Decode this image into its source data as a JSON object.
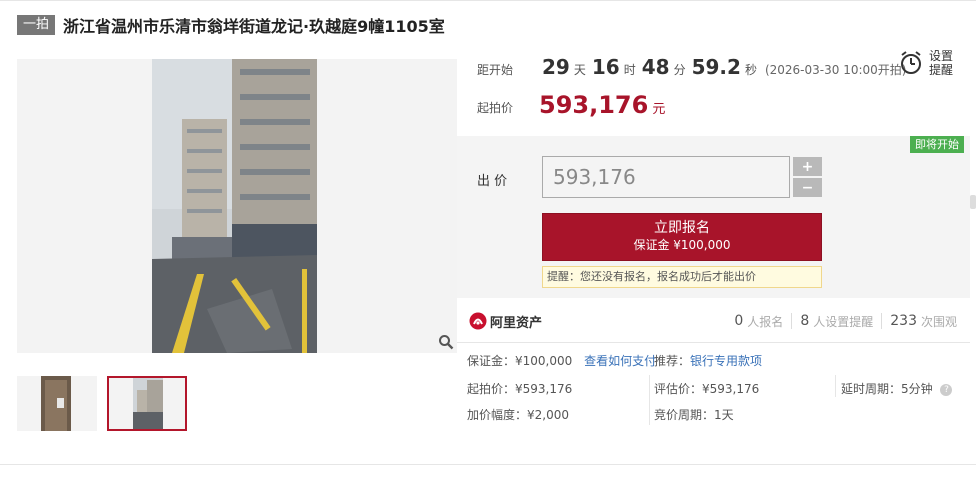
{
  "header": {
    "round_tag": "一拍",
    "title": "浙江省温州市乐清市翁垟街道龙记·玖越庭9幢1105室"
  },
  "colors": {
    "accent": "#a8142a",
    "badge_green": "#4caf50",
    "link_blue": "#3a72b8"
  },
  "gallery": {
    "zoom_icon": "magnifier-icon",
    "thumbnails": [
      "thumbnail-1",
      "thumbnail-2"
    ],
    "selected_index": 1
  },
  "countdown": {
    "label": "距开始",
    "days": "29",
    "days_unit": "天",
    "hours": "16",
    "hours_unit": "时",
    "minutes": "48",
    "minutes_unit": "分",
    "seconds": "59.2",
    "seconds_unit": "秒",
    "start_note": "(2026-03-30 10:00开拍)"
  },
  "remind": {
    "icon": "alarm-clock-icon",
    "line1": "设置",
    "line2": "提醒"
  },
  "start_price": {
    "label": "起拍价",
    "value": "593,176",
    "unit": "元"
  },
  "bid": {
    "status_badge": "即将开始",
    "label": "出 价",
    "input_value": "593,176",
    "plus": "+",
    "minus": "−",
    "apply_label": "立即报名",
    "deposit_label": "保证金 ¥100,000",
    "tip": "提醒：您还没有报名，报名成功后才能出价"
  },
  "platform": {
    "logo_text": "阿里资产",
    "registrations": "0",
    "registrations_label": "人报名",
    "reminders": "8",
    "reminders_label": "人设置提醒",
    "views": "233",
    "views_label": "次围观"
  },
  "info": {
    "deposit_key": "保证金：",
    "deposit_value": "¥100,000",
    "deposit_link": "查看如何支付",
    "recommend_key": "推荐：",
    "recommend_link": "银行专用款项",
    "start_key": "起拍价：",
    "start_value": "¥593,176",
    "appraisal_key": "评估价：",
    "appraisal_value": "¥593,176",
    "delay_key": "延时周期：",
    "delay_value": "5分钟",
    "increment_key": "加价幅度：",
    "increment_value": "¥2,000",
    "cycle_key": "竞价周期：",
    "cycle_value": "1天",
    "help_icon": "?"
  }
}
